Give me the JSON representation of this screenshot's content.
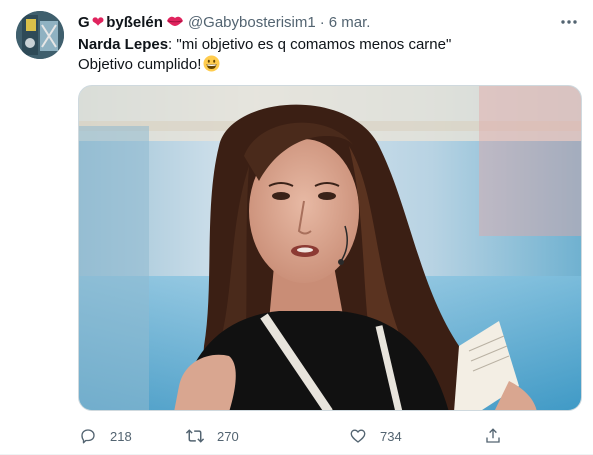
{
  "tweet": {
    "author": {
      "name_part1": "G",
      "name_heart": "❤",
      "name_part2": "byßelén",
      "handle": "@Gabybosterisim1",
      "separator": "·",
      "date": "6 mar.",
      "avatar_icon": "profile-avatar"
    },
    "text": {
      "speaker": "Narda Lepes",
      "quote": ": \"mi objetivo es q comamos menos carne\"",
      "line2": "Objetivo cumplido!",
      "emoji": "grinning-face-emoji"
    },
    "media": {
      "description_icon": "photo-woman-speaking"
    },
    "actions": {
      "reply_count": "218",
      "retweet_count": "270",
      "like_count": "734"
    },
    "colors": {
      "text_primary": "#0f1419",
      "text_secondary": "#536471",
      "heart": "#e0245e"
    }
  }
}
